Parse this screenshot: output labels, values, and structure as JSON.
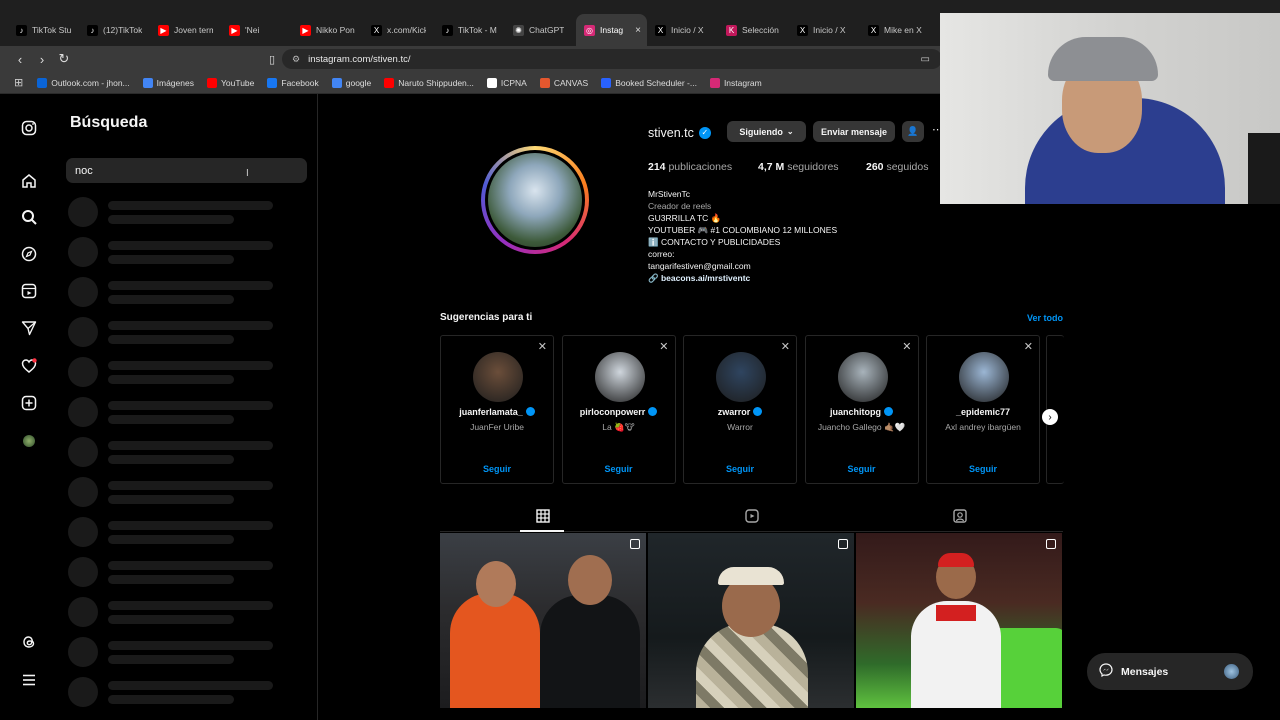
{
  "browser": {
    "tabs": [
      {
        "label": "TikTok Stu",
        "color": "#000000",
        "glyph": "♪"
      },
      {
        "label": "(12)TikTok",
        "color": "#000000",
        "glyph": "♪"
      },
      {
        "label": "Joven term",
        "color": "#ff0000",
        "glyph": "▶"
      },
      {
        "label": "'Nei",
        "color": "#ff0000",
        "glyph": "▶"
      },
      {
        "label": "Nikko Pon",
        "color": "#ff0000",
        "glyph": "▶"
      },
      {
        "label": "x.com/Kick",
        "color": "#000000",
        "glyph": "X"
      },
      {
        "label": "TikTok - M",
        "color": "#000000",
        "glyph": "♪"
      },
      {
        "label": "ChatGPT",
        "color": "#444444",
        "glyph": "✺"
      },
      {
        "label": "Instag",
        "color": "#d62976",
        "glyph": "◎"
      },
      {
        "label": "Inicio / X",
        "color": "#000000",
        "glyph": "X"
      },
      {
        "label": "Selección",
        "color": "#c2185b",
        "glyph": "K"
      },
      {
        "label": "Inicio / X",
        "color": "#000000",
        "glyph": "X"
      },
      {
        "label": "Mike en X",
        "color": "#000000",
        "glyph": "X"
      }
    ],
    "url": "instagram.com/stiven.tc/",
    "bookmarks": [
      {
        "label": "Outlook.com - jhon...",
        "color": "#0a64d6"
      },
      {
        "label": "Imágenes",
        "color": "#4285f4"
      },
      {
        "label": "YouTube",
        "color": "#ff0000"
      },
      {
        "label": "Facebook",
        "color": "#1877f2"
      },
      {
        "label": "google",
        "color": "#4285f4"
      },
      {
        "label": "Naruto Shippuden...",
        "color": "#ff0000"
      },
      {
        "label": "ICPNA",
        "color": "#ffffff"
      },
      {
        "label": "CANVAS",
        "color": "#e4572e"
      },
      {
        "label": "Booked Scheduler -...",
        "color": "#2962ff"
      },
      {
        "label": "Instagram",
        "color": "#d62976"
      }
    ]
  },
  "search": {
    "title": "Búsqueda",
    "query": "noc"
  },
  "profile": {
    "username": "stiven.tc",
    "following_label": "Siguiendo",
    "message_label": "Enviar mensaje",
    "posts_count": "214",
    "posts_label": "publicaciones",
    "followers_count": "4,7 M",
    "followers_label": "seguidores",
    "following_count": "260",
    "following_label2": "seguidos",
    "bio_name": "MrStivenTc",
    "bio_category": "Creador de reels",
    "bio_lines": [
      "GU3RRILLA TC 🔥",
      "YOUTUBER 🎮 #1 COLOMBIANO 12 MILLONES",
      "ℹ️ CONTACTO Y PUBLICIDADES",
      "correo:",
      "tangarifestiven@gmail.com"
    ],
    "bio_link": "beacons.ai/mrstiventc"
  },
  "suggestions": {
    "title": "Sugerencias para ti",
    "see_all": "Ver todo",
    "follow_label": "Seguir",
    "cards": [
      {
        "username": "juanferlamata_",
        "subtitle": "JuanFer Uribe",
        "verified": true,
        "color": "#6b4e3a"
      },
      {
        "username": "pirloconpowerr",
        "subtitle": "La 🍓🐮",
        "verified": true,
        "color": "#cfd6dd"
      },
      {
        "username": "zwarror",
        "subtitle": "Warror",
        "verified": true,
        "color": "#2f4560"
      },
      {
        "username": "juanchitopg",
        "subtitle": "Juancho Gallego 🤙🏽🤍",
        "verified": true,
        "color": "#a8b3bb"
      },
      {
        "username": "_epidemic77",
        "subtitle": "Axl andrey ibargüen",
        "verified": false,
        "color": "#9bb6d4"
      }
    ]
  },
  "messages": {
    "label": "Mensajes"
  }
}
